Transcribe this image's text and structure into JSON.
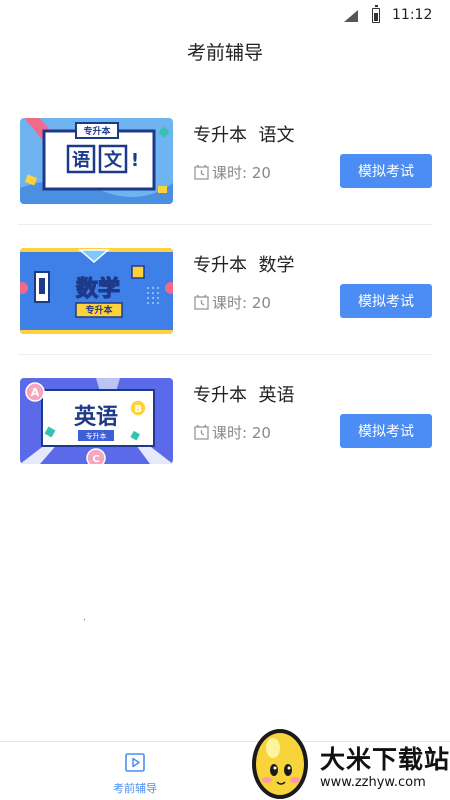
{
  "status_bar": {
    "time": "11:12"
  },
  "header": {
    "title": "考前辅导"
  },
  "courses": [
    {
      "title": "专升本  语文",
      "hours": "课时: 20",
      "button": "模拟考试",
      "thumb": {
        "tag": "专升本",
        "chars": [
          "语",
          "文",
          "!"
        ]
      }
    },
    {
      "title": "专升本  数学",
      "hours": "课时: 20",
      "button": "模拟考试",
      "thumb": {
        "tag": "专升本",
        "word": "数学"
      }
    },
    {
      "title": "专升本  英语",
      "hours": "课时: 20",
      "button": "模拟考试",
      "thumb": {
        "tag": "专升本",
        "word": "英语",
        "letters": [
          "A",
          "B",
          "C"
        ]
      }
    }
  ],
  "tab_bar": {
    "items": [
      {
        "label": "考前辅导",
        "icon": "play-icon"
      }
    ]
  },
  "watermark": {
    "title": "大米下载站",
    "url": "www.zzhyw.com"
  },
  "colors": {
    "accent": "#4b8df5",
    "text": "#222222",
    "muted": "#888888"
  }
}
